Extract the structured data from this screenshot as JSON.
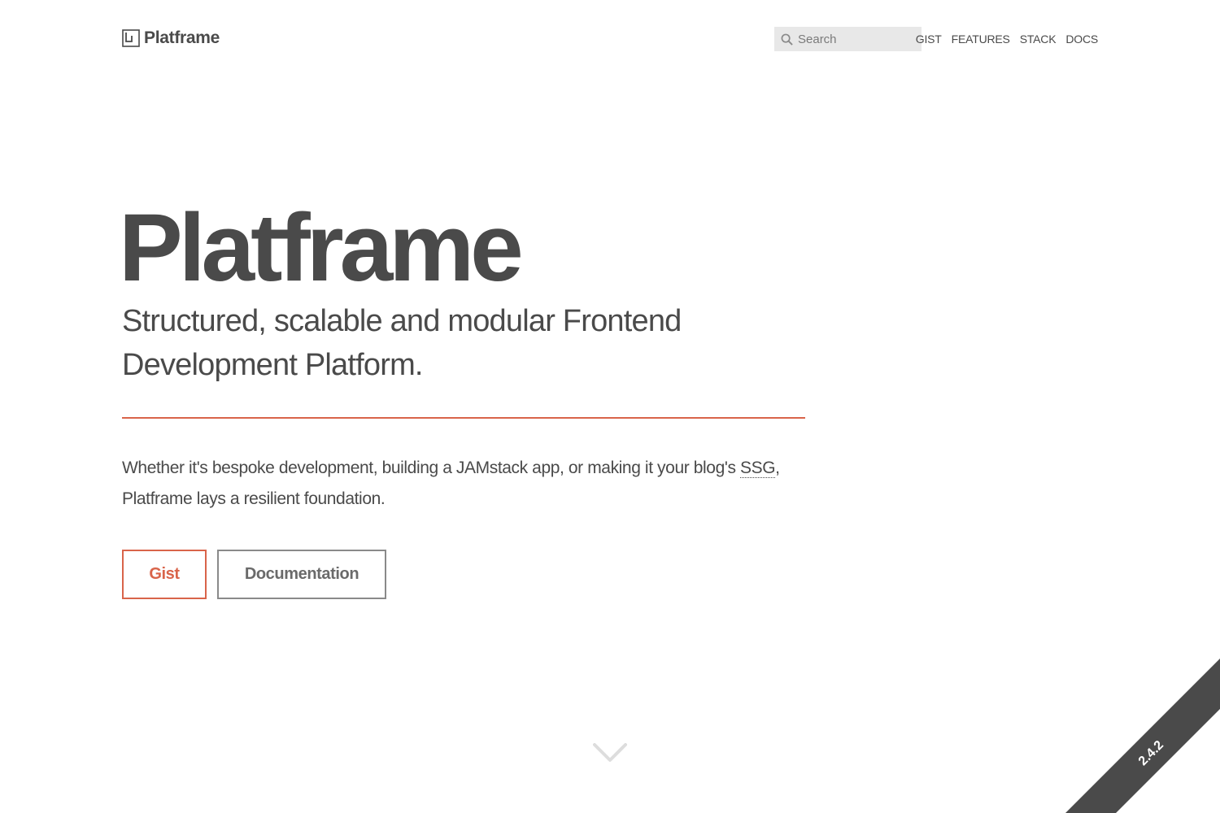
{
  "header": {
    "brand": {
      "name": "Platframe",
      "icon": "platframe-logo-icon"
    },
    "search": {
      "placeholder": "Search",
      "value": "",
      "icon": "search-icon"
    },
    "nav": [
      {
        "label": "GIST"
      },
      {
        "label": "FEATURES"
      },
      {
        "label": "STACK"
      },
      {
        "label": "DOCS"
      }
    ]
  },
  "hero": {
    "title": "Platframe",
    "subtitle": "Structured, scalable and modular Frontend Development Platform.",
    "lead_before": "Whether it's bespoke development, building a JAMstack app, or making it your blog's ",
    "lead_abbr": "SSG",
    "lead_after": ", Platframe lays a resilient foundation.",
    "buttons": {
      "gist": "Gist",
      "docs": "Documentation"
    },
    "scroll_icon": "chevron-down-icon"
  },
  "ribbon": {
    "version": "2.4.2"
  },
  "colors": {
    "text": "#4a4a4a",
    "accent": "#d9644a",
    "search_bg": "#e8e8e8",
    "ribbon": "#4a4a4a",
    "chevron": "#dddddd"
  }
}
